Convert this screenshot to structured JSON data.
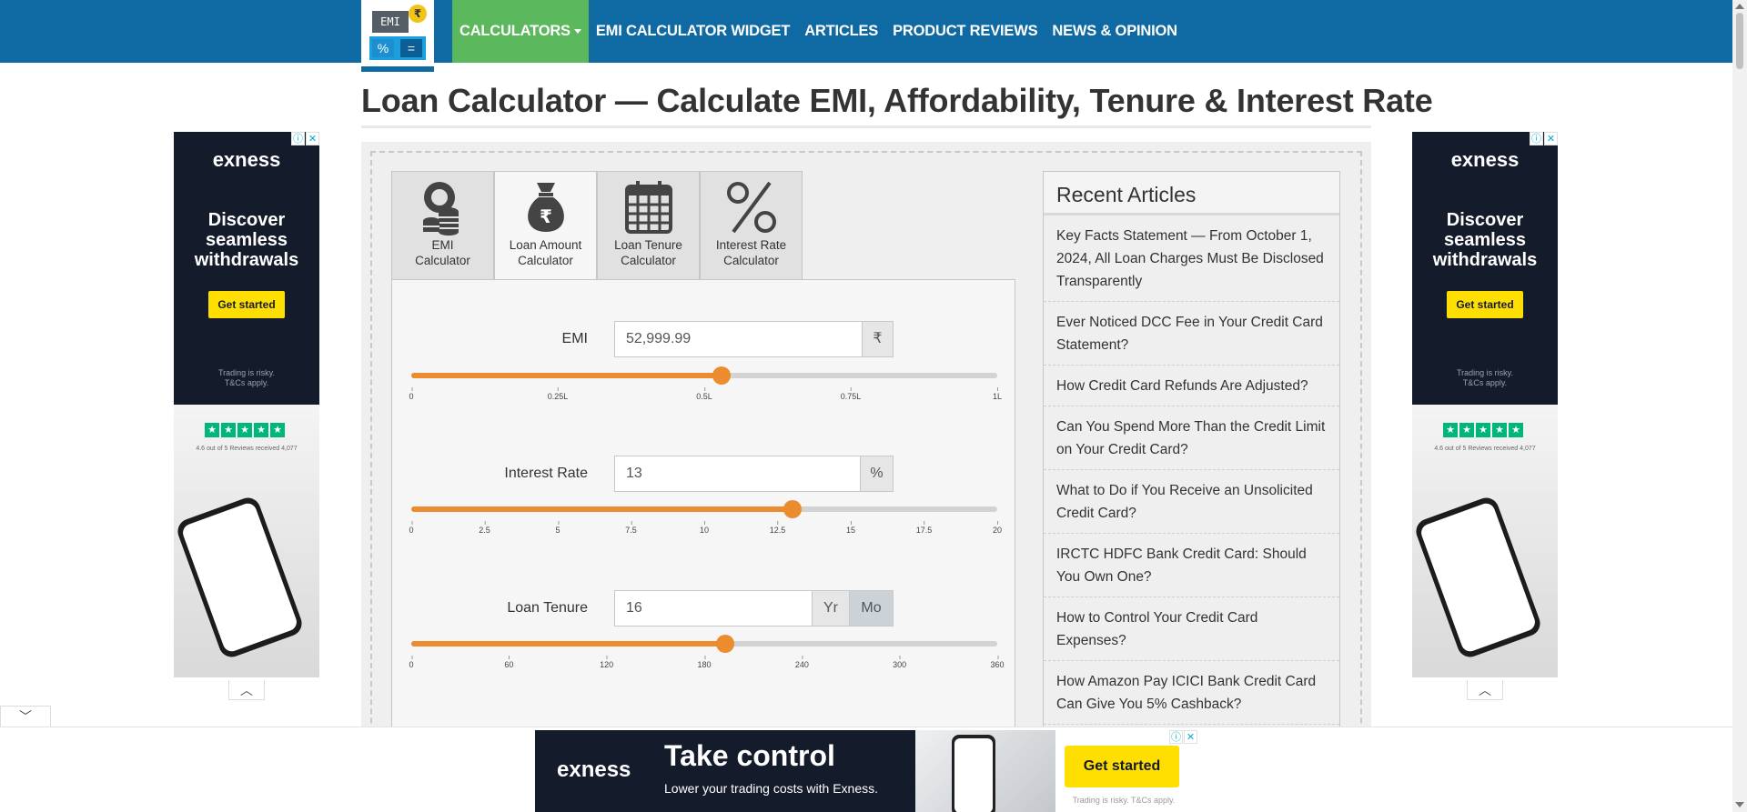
{
  "logo": {
    "screen_text": "EMI",
    "coin_symbol": "₹",
    "key_percent": "%",
    "key_equals": "="
  },
  "nav": {
    "items": [
      {
        "label": "CALCULATORS",
        "active": true
      },
      {
        "label": "EMI CALCULATOR WIDGET"
      },
      {
        "label": "ARTICLES"
      },
      {
        "label": "PRODUCT REVIEWS"
      },
      {
        "label": "NEWS & OPINION"
      }
    ]
  },
  "page_title": "Loan Calculator — Calculate EMI, Affordability, Tenure & Interest Rate",
  "tabs": [
    {
      "line1": "EMI",
      "line2": "Calculator",
      "icon": "coins-stack-icon"
    },
    {
      "line1": "Loan Amount",
      "line2": "Calculator",
      "icon": "money-bag-rupee-icon",
      "active": true
    },
    {
      "line1": "Loan Tenure",
      "line2": "Calculator",
      "icon": "calendar-icon"
    },
    {
      "line1": "Interest Rate",
      "line2": "Calculator",
      "icon": "percent-icon"
    }
  ],
  "fields": {
    "emi": {
      "label": "EMI",
      "value": "52,999.99",
      "addon": "₹",
      "slider_fraction": 0.53,
      "ticks": [
        "0",
        "0.25L",
        "0.5L",
        "0.75L",
        "1L"
      ]
    },
    "interest": {
      "label": "Interest Rate",
      "value": "13",
      "addon": "%",
      "slider_fraction": 0.65,
      "ticks": [
        "0",
        "2.5",
        "5",
        "7.5",
        "10",
        "12.5",
        "15",
        "17.5",
        "20"
      ]
    },
    "tenure": {
      "label": "Loan Tenure",
      "value": "16",
      "addon_year": "Yr",
      "addon_month": "Mo",
      "slider_fraction": 0.535,
      "ticks": [
        "0",
        "60",
        "120",
        "180",
        "240",
        "300",
        "360"
      ]
    }
  },
  "recent": {
    "title": "Recent Articles",
    "items": [
      "Key Facts Statement — From October 1, 2024, All Loan Charges Must Be Disclosed Transparently",
      "Ever Noticed DCC Fee in Your Credit Card Statement?",
      "How Credit Card Refunds Are Adjusted?",
      "Can You Spend More Than the Credit Limit on Your Credit Card?",
      "What to Do if You Receive an Unsolicited Credit Card?",
      "IRCTC HDFC Bank Credit Card: Should You Own One?",
      "How to Control Your Credit Card Expenses?",
      "How Amazon Pay ICICI Bank Credit Card Can Give You 5% Cashback?"
    ]
  },
  "side_ad": {
    "brand": "exness",
    "headline": "Discover seamless withdrawals",
    "cta": "Get started",
    "disclaimer_1": "Trading is risky.",
    "disclaimer_2": "T&Cs apply.",
    "rating_text": "4.6 out of 5 Reviews received 4,077",
    "info_glyph": "ⓘ",
    "close_glyph": "✕"
  },
  "bottom_ad": {
    "brand": "exness",
    "headline": "Take control",
    "subline": "Lower your trading costs with Exness.",
    "cta": "Get started",
    "disclaimer": "Trading is risky. T&Cs apply."
  },
  "colors": {
    "nav_bg": "#0f6aa3",
    "nav_active": "#5cb85c",
    "slider": "#ed8c2f",
    "ad_bg": "#141b2b",
    "ad_cta": "#ffde02"
  }
}
